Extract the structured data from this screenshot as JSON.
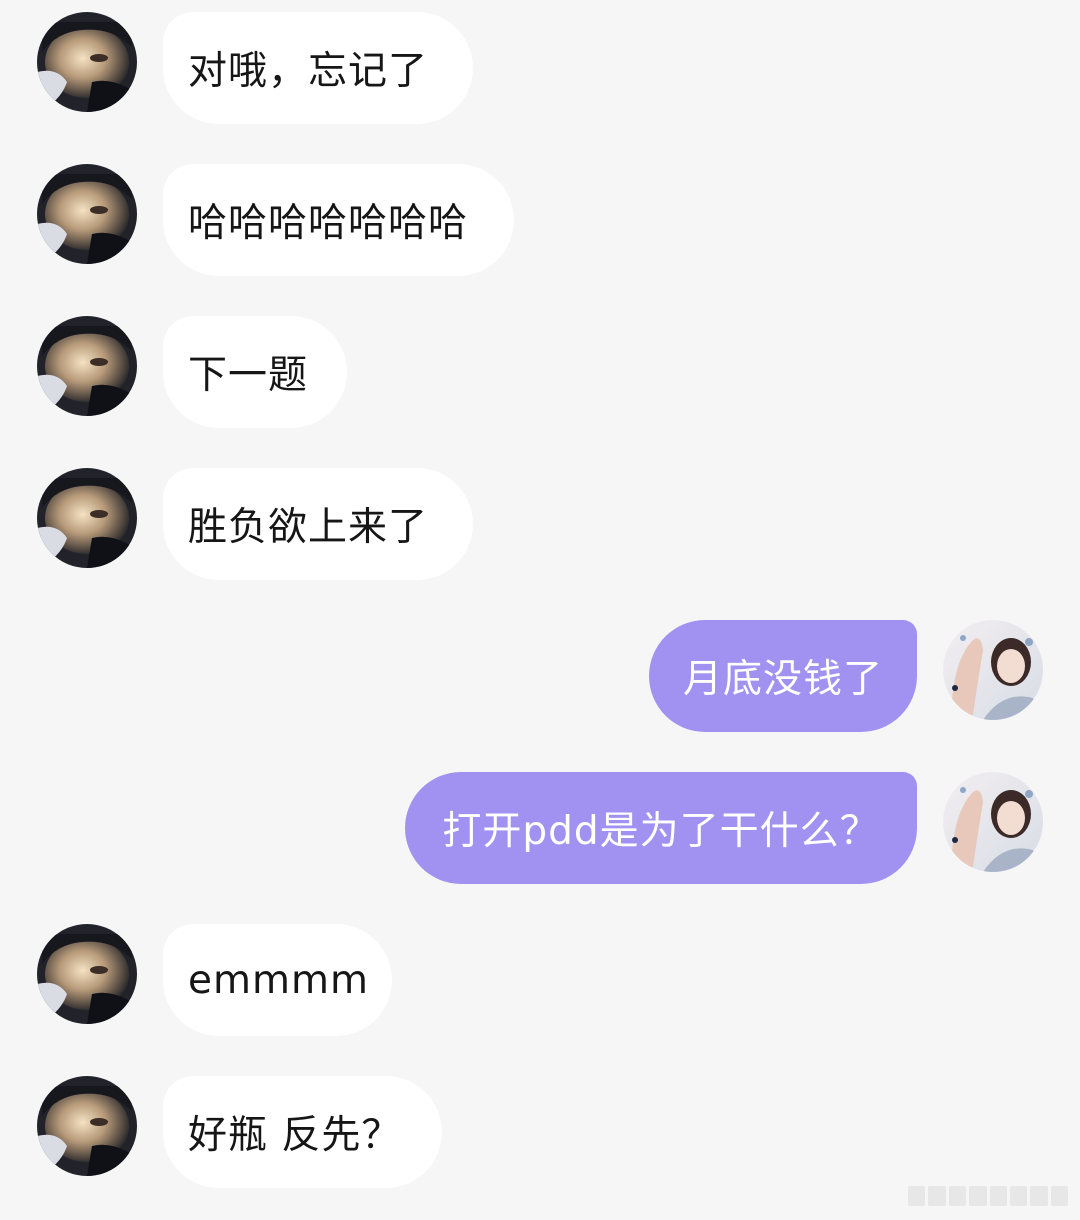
{
  "conversation": {
    "messages": [
      {
        "side": "left",
        "text": "对哦，忘记了"
      },
      {
        "side": "left",
        "text": "哈哈哈哈哈哈哈"
      },
      {
        "side": "left",
        "text": "下一题"
      },
      {
        "side": "left",
        "text": "胜负欲上来了"
      },
      {
        "side": "right",
        "text": "月底没钱了"
      },
      {
        "side": "right",
        "text": "打开pdd是为了干什么？"
      },
      {
        "side": "left",
        "text": "emmmm"
      },
      {
        "side": "left",
        "text": "好瓶 反先？"
      }
    ]
  },
  "avatars": {
    "contact": {
      "icon": "contact-avatar-photo"
    },
    "self": {
      "icon": "self-avatar-photo"
    }
  },
  "colors": {
    "background": "#f6f6f6",
    "incoming_bubble": "#ffffff",
    "outgoing_bubble": "#a192f2",
    "incoming_text": "#161616",
    "outgoing_text": "#ffffff"
  }
}
